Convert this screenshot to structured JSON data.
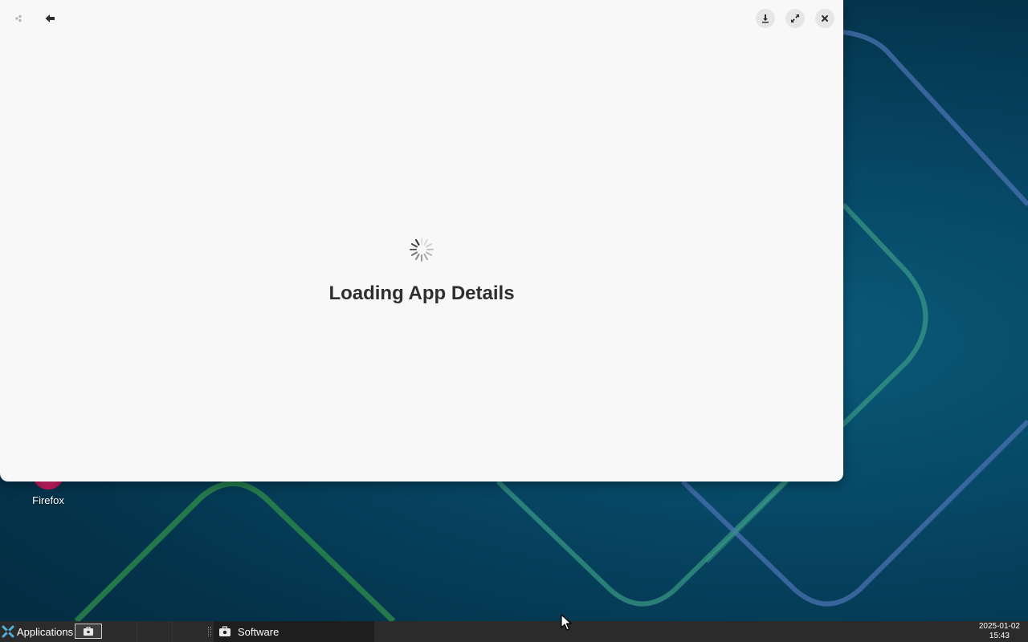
{
  "window": {
    "loading_title": "Loading App Details",
    "header_buttons": {
      "app_icon": "software-icon",
      "back": "back-arrow-icon",
      "download": "download-icon",
      "maximize": "maximize-icon",
      "close": "close-icon"
    }
  },
  "desktop": {
    "icons": [
      {
        "label": "Firefox",
        "icon": "firefox-icon"
      }
    ]
  },
  "taskbar": {
    "applications_label": "Applications",
    "tasks": [
      {
        "label": "Software",
        "icon": "software-icon"
      }
    ],
    "clock": {
      "date": "2025-01-02",
      "time": "15:43"
    }
  },
  "colors": {
    "window_bg": "#f8f8f8",
    "taskbar_bg": "#2b2b2b",
    "desktop_bg": "#064866",
    "accent_xfce": "#4fb3d9"
  }
}
